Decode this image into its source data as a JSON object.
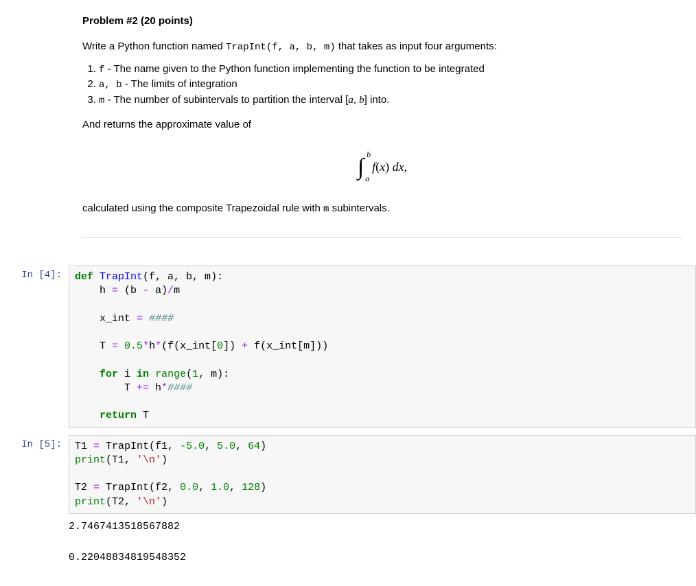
{
  "problem": {
    "heading": "Problem #2 (20 points)",
    "intro_pre": "Write a Python function named ",
    "intro_code": "TrapInt(f, a, b, m)",
    "intro_post": " that takes as input four arguments:",
    "items": [
      {
        "code": "f",
        "text": " - The name given to the Python function implementing the function to be integrated"
      },
      {
        "code": "a, b",
        "text": " - The limits of integration"
      },
      {
        "code": "m",
        "text_pre": " - The number of subintervals to partition the interval [",
        "var1": "a",
        "comma": ", ",
        "var2": "b",
        "text_post": "] into."
      }
    ],
    "returns_line": "And returns the approximate value of",
    "integral": {
      "lower": "a",
      "upper": "b",
      "integrand_f": "f",
      "integrand_paren_open": "(",
      "integrand_x": "x",
      "integrand_paren_close": ") ",
      "dx_d": "d",
      "dx_x": "x",
      "comma": ","
    },
    "closing_pre": "calculated using the composite Trapezoidal rule with ",
    "closing_code": "m",
    "closing_post": " subintervals."
  },
  "cells": [
    {
      "prompt": "In [4]:",
      "tokens": {
        "def": "def",
        "fname": "TrapInt",
        "sig": "(f, a, b, m):",
        "l2a": "    h ",
        "eq": "=",
        "l2b": " (b ",
        "minus": "-",
        "l2c": " a)",
        "div": "/",
        "l2d": "m",
        "l3a": "    x_int ",
        "l3b": " ",
        "comment1": "####",
        "l4a": "    T ",
        "l4b": " ",
        "num05": "0.5",
        "star": "*",
        "l4c": "h",
        "l4d": "(f(x_int[",
        "num0": "0",
        "l4e": "]) ",
        "plus": "+",
        "l4f": " f(x_int[m]))",
        "for": "for",
        "l5a": " i ",
        "in": "in",
        "l5b": " ",
        "range": "range",
        "l5c": "(",
        "num1": "1",
        "l5d": ", m):",
        "l6a": "        T ",
        "pluseq": "+=",
        "l6b": " h",
        "comment2": "####",
        "return": "return",
        "l7a": " T"
      }
    },
    {
      "prompt": "In [5]:",
      "tokens": {
        "t1": "T1 ",
        "eq": "=",
        "sp": " ",
        "trapint": "TrapInt(f1, ",
        "neg5": "-5.0",
        "comma_sp": ", ",
        "pos5": "5.0",
        "n64": "64",
        "paren_close": ")",
        "print1a": "print(T1, ",
        "nl_str": "'\\n'",
        "print1b": ")",
        "t2": "T2 ",
        "trapint2": "TrapInt(f2, ",
        "zero": "0.0",
        "one": "1.0",
        "n128": "128",
        "print2a": "print(T2, "
      },
      "output": "2.7467413518567882 \n\n0.22048834819548352 "
    }
  ]
}
